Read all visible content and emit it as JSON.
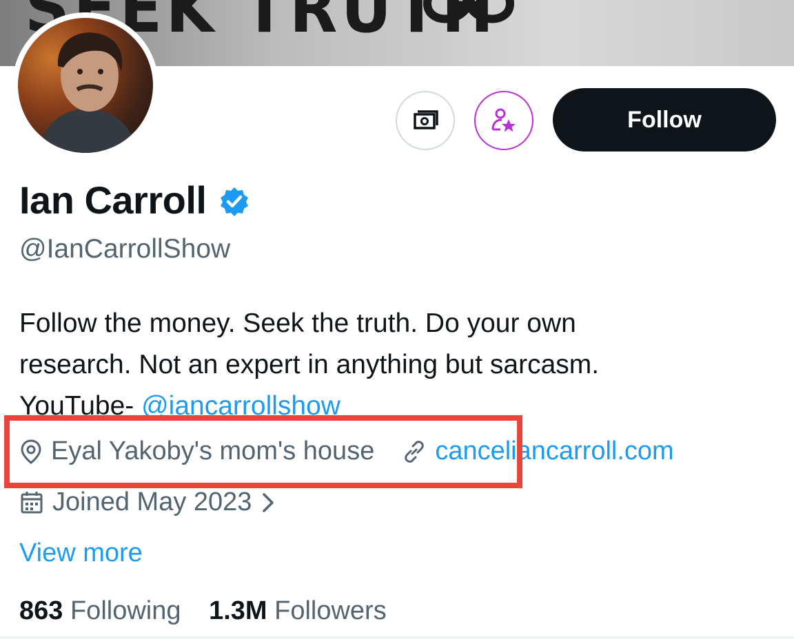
{
  "banner": {
    "text": "SEEK TRUTH",
    "logo_icon": "infinity-mark-icon"
  },
  "profile": {
    "avatar_icon": "profile-photo",
    "display_name": "Ian Carroll",
    "verified_icon": "verified-badge-icon",
    "handle": "@IanCarrollShow",
    "bio_lines": [
      "Follow the money. Seek the truth. Do your own",
      "research. Not an expert in anything but sarcasm."
    ],
    "bio_youtube_prefix": "YouTube- ",
    "bio_youtube_link": "@iancarrollshow",
    "location": "Eyal Yakoby's mom's house",
    "website": "canceliancarroll.com",
    "joined": "Joined May 2023",
    "view_more": "View more",
    "following_count": "863",
    "following_label": "Following",
    "followers_count": "1.3M",
    "followers_label": "Followers"
  },
  "actions": {
    "tip_icon": "money-tip-icon",
    "subscribe_icon": "subscribe-person-star-icon",
    "follow_label": "Follow"
  },
  "colors": {
    "link": "#1d9bf0",
    "highlight_box": "#e8453c",
    "subscribe_accent": "#b92fd4",
    "verified": "#1d9bf0"
  }
}
